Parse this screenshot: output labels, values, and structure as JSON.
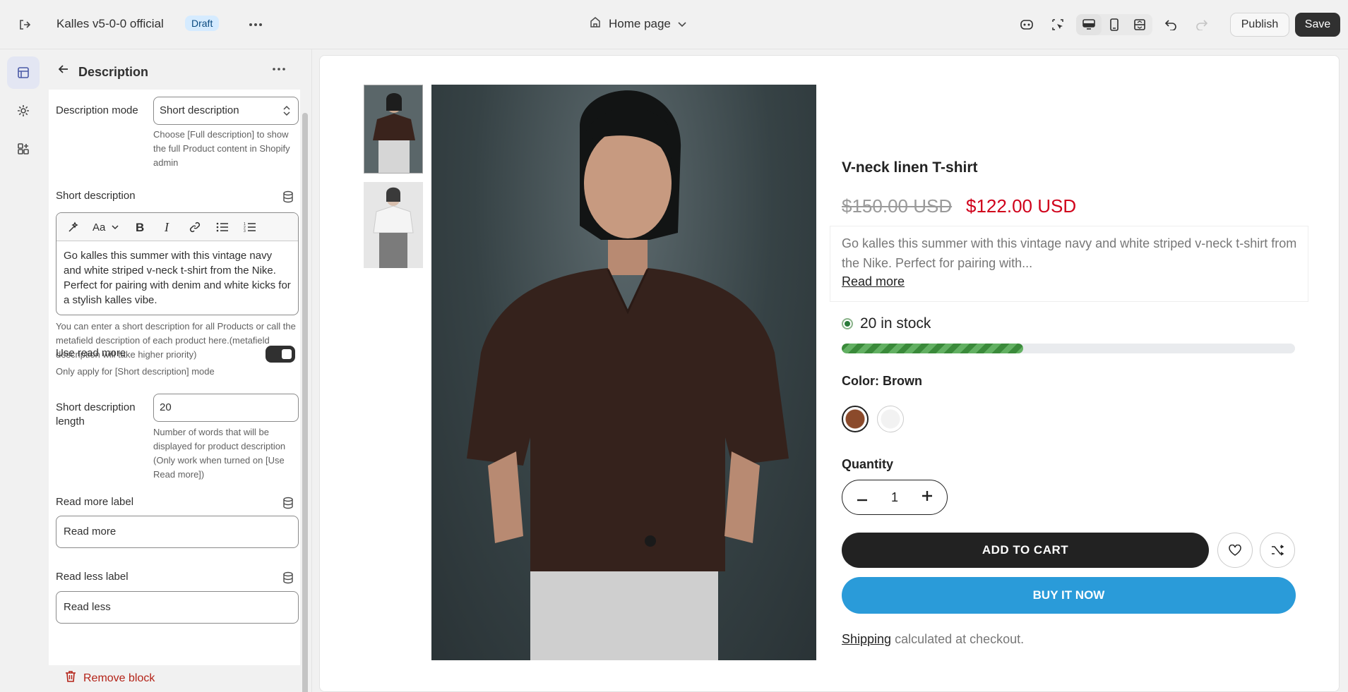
{
  "topbar": {
    "store_name": "Kalles v5-0-0 official",
    "status_badge": "Draft",
    "page_select": "Home page",
    "publish_label": "Publish",
    "save_label": "Save"
  },
  "panel": {
    "title": "Description",
    "description_mode": {
      "label": "Description mode",
      "value": "Short description",
      "help": "Choose [Full description] to show the full Product content in Shopify admin"
    },
    "short_description": {
      "label": "Short description",
      "content": "Go kalles this summer with this vintage navy and white striped v-neck t-shirt from the Nike. Perfect for pairing with denim and white kicks for a stylish kalles vibe.",
      "help": "You can enter a short description for all Products or call the metafield description of each product here.(metafield description will take higher priority)"
    },
    "use_read_more": {
      "label": "Use read more",
      "enabled": true,
      "help": "Only apply for [Short description] mode"
    },
    "short_description_length": {
      "label": "Short description length",
      "value": "20",
      "help": "Number of words that will be displayed for product description (Only work when turned on [Use Read more])"
    },
    "read_more_label": {
      "label": "Read more label",
      "value": "Read more"
    },
    "read_less_label": {
      "label": "Read less label",
      "value": "Read less"
    },
    "remove_block": "Remove block"
  },
  "product": {
    "title": "V-neck linen T-shirt",
    "compare_price": "$150.00 USD",
    "price": "$122.00 USD",
    "description": "Go kalles this summer with this vintage navy and white striped v-neck t-shirt from the Nike. Perfect for pairing with...",
    "read_more": "Read more",
    "stock_text": "20 in stock",
    "stock_level": 0.4,
    "color_label": "Color: Brown",
    "quantity_label": "Quantity",
    "quantity": "1",
    "add_to_cart": "ADD TO CART",
    "buy_now": "BUY IT NOW",
    "shipping_link": "Shipping",
    "shipping_rest": " calculated at checkout."
  },
  "colors": {
    "accent_dark": "#303030",
    "price_red": "#d0021b",
    "buy_blue": "#2a9bd9",
    "swatch_brown": "#8b4a2b",
    "swatch_white": "#f2f2f2"
  }
}
